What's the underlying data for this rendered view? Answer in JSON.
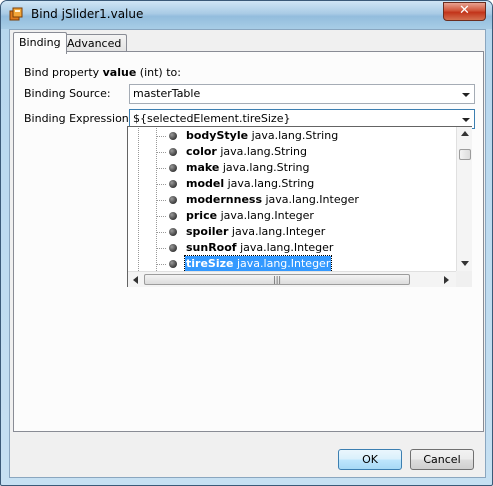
{
  "window": {
    "title": "Bind jSlider1.value",
    "close_glyph": "✕",
    "icon": "java-app-icon"
  },
  "tabs": [
    {
      "label": "Binding",
      "active": true
    },
    {
      "label": "Advanced",
      "active": false
    }
  ],
  "binding": {
    "property_prefix": "Bind property ",
    "property_name": "value",
    "property_suffix": " (int) to:",
    "source_label": "Binding Source:",
    "source_value": "masterTable",
    "expression_label": "Binding Expression:",
    "expression_value": "${selectedElement.tireSize}"
  },
  "tree_items": [
    {
      "name": "bodyStyle",
      "type": "java.lang.String",
      "selected": false
    },
    {
      "name": "color",
      "type": "java.lang.String",
      "selected": false
    },
    {
      "name": "make",
      "type": "java.lang.String",
      "selected": false
    },
    {
      "name": "model",
      "type": "java.lang.String",
      "selected": false
    },
    {
      "name": "modernness",
      "type": "java.lang.Integer",
      "selected": false
    },
    {
      "name": "price",
      "type": "java.lang.Integer",
      "selected": false
    },
    {
      "name": "spoiler",
      "type": "java.lang.Integer",
      "selected": false
    },
    {
      "name": "sunRoof",
      "type": "java.lang.Integer",
      "selected": false
    },
    {
      "name": "tireSize",
      "type": "java.lang.Integer",
      "selected": true
    }
  ],
  "scroll_grip": "|||",
  "buttons": {
    "ok": "OK",
    "cancel": "Cancel"
  },
  "colors": {
    "selection": "#3399ff",
    "close_button": "#c2341a",
    "title_bar": "#a9cbe5"
  }
}
